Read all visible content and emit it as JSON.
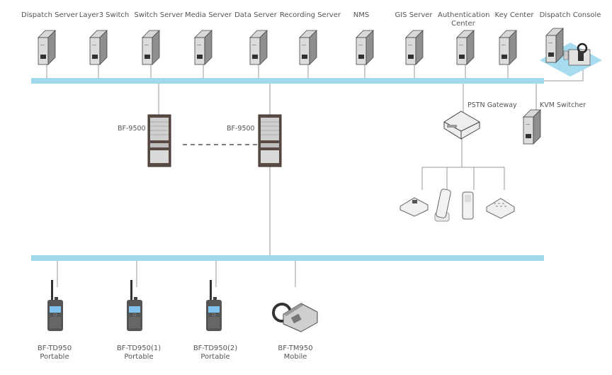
{
  "servers": [
    {
      "label": "Dispatch Server",
      "icon": "server-icon"
    },
    {
      "label": "Layer3 Switch",
      "icon": "server-icon"
    },
    {
      "label": "Switch Server",
      "icon": "server-icon"
    },
    {
      "label": "Media Server",
      "icon": "server-icon"
    },
    {
      "label": "Data Server",
      "icon": "server-icon"
    },
    {
      "label": "Recording Server",
      "icon": "server-icon"
    },
    {
      "label": "NMS",
      "icon": "server-icon"
    },
    {
      "label": "GIS Server",
      "icon": "server-icon"
    },
    {
      "label": "Authentication Center",
      "icon": "server-icon"
    },
    {
      "label": "Key Center",
      "icon": "server-icon"
    },
    {
      "label": "Dispatch Console",
      "icon": "dispatch-console-icon"
    }
  ],
  "racks": [
    {
      "label": "BF-9500"
    },
    {
      "label": "BF-9500"
    }
  ],
  "pstn": {
    "label": "PSTN Gateway",
    "icon": "gateway-icon"
  },
  "kvm": {
    "label": "KVM Switcher",
    "icon": "server-icon"
  },
  "phones": [
    "desk-phone-icon",
    "cordless-phone-icon",
    "mobile-phone-icon",
    "keypad-phone-icon"
  ],
  "terminals": [
    {
      "model": "BF-TD950",
      "type": "Portable",
      "icon": "portable-radio-icon"
    },
    {
      "model": "BF-TD950(1)",
      "type": "Portable",
      "icon": "portable-radio-icon"
    },
    {
      "model": "BF-TD950(2)",
      "type": "Portable",
      "icon": "portable-radio-icon"
    },
    {
      "model": "BF-TM950",
      "type": "Mobile",
      "icon": "mobile-radio-icon"
    }
  ],
  "colors": {
    "bus": "#a0d8ec",
    "line": "#999999",
    "device": "#8a8a8a"
  }
}
